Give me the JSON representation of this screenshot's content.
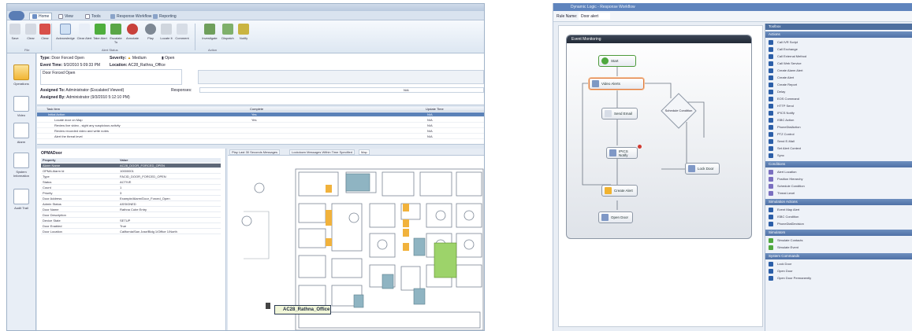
{
  "left_app": {
    "tabs": [
      {
        "label": "Home",
        "active": true
      },
      {
        "label": "View",
        "active": false
      },
      {
        "label": "Tools",
        "active": false
      },
      {
        "label": "Response Workflow",
        "active": false
      },
      {
        "label": "Reporting",
        "active": false
      }
    ],
    "ribbon_buttons": [
      "Save",
      "Clear",
      "Acknowledge",
      "Clear Alert",
      "Take Alert",
      "Escalate To",
      "Annotate",
      "Play",
      "Locate It",
      "Comment",
      "Investigate",
      "Dispatch",
      "Notify"
    ],
    "ribbon_groups": [
      "File",
      "Alert Status",
      "Action"
    ],
    "nav": [
      {
        "label": "Operations",
        "active": true
      },
      {
        "label": "Video",
        "active": false
      },
      {
        "label": "Alarm",
        "active": false
      },
      {
        "label": "System Information",
        "active": false
      },
      {
        "label": "Audit Trail",
        "active": false
      }
    ],
    "event": {
      "type_label": "Type:",
      "type_value": "Door Forced Open",
      "severity_label": "Severity:",
      "severity_value": "Medium",
      "state_value": "Open",
      "time_label": "Event Time:",
      "time_value": "9/3/2010 5:09:33 PM",
      "location_label": "Location:",
      "location_value": "AC28_Rathna_Office",
      "description": "Door Forced Open",
      "assigned_label": "Assigned To:",
      "assigned_value": "Administrator (Escalated Viewed)",
      "by_label": "Assigned By:",
      "by_value": "Administrator (9/3/2010 5:12:10 PM)",
      "resp_label": "Responses:",
      "resp_value": "N/A"
    },
    "tasks": {
      "headers": [
        "Task Item",
        "Complete",
        "Update Time"
      ],
      "rows": [
        {
          "name": "Initial Action",
          "complete": "Yes",
          "time": "N/A",
          "selected": true
        },
        {
          "name": "Locate door on Map",
          "complete": "Yes",
          "time": "N/A",
          "selected": false
        },
        {
          "name": "Review live video - sight any suspicious activity",
          "complete": "",
          "time": "N/A",
          "selected": false
        },
        {
          "name": "Review recorded video and write notes",
          "complete": "",
          "time": "N/A",
          "selected": false
        },
        {
          "name": "Alert the threat level",
          "complete": "",
          "time": "N/A",
          "selected": false
        }
      ]
    },
    "props": {
      "title": "OPMADoor",
      "headers": [
        "Property",
        "Value"
      ],
      "rows": [
        {
          "k": "Alarm Name",
          "v": "AC28_DOOR_FORCED_OPEN",
          "sel": true
        },
        {
          "k": "OPMA Alarm Id",
          "v": "10000001",
          "sel": false
        },
        {
          "k": "Type",
          "v": "FACID_DOOR_FORCED_OPEN",
          "sel": false
        },
        {
          "k": "Status",
          "v": "ACTIVE",
          "sel": false
        },
        {
          "k": "Count",
          "v": "1",
          "sel": false
        },
        {
          "k": "Priority",
          "v": "3",
          "sel": false
        },
        {
          "k": "Door Address",
          "v": "Example/Alarm/Door_Forced_Open",
          "sel": false
        },
        {
          "k": "Admin Status",
          "v": "ASSIGNED",
          "sel": false
        },
        {
          "k": "Door Name",
          "v": "Rathna Cube Entry",
          "sel": false
        },
        {
          "k": "Door Description",
          "v": "",
          "sel": false
        },
        {
          "k": "Device State",
          "v": "SETUP",
          "sel": false
        },
        {
          "k": "Door Enabled",
          "v": "True",
          "sel": false
        },
        {
          "k": "Door Location",
          "v": "California/San Jose/Bldg 1/Office 1/North",
          "sel": false
        }
      ]
    },
    "map_tabs": [
      "Play Last 30 Seconds Messages",
      "Lockdown Messages Within Time Specified",
      "Map"
    ],
    "map_label": "AC28_Rathna_Office"
  },
  "right_app": {
    "title": "Dynamic Logic - Response Workflow",
    "name_label": "Rule Name:",
    "name_value": "Door alert",
    "canvas_title": "Event Monitoring",
    "nodes": {
      "start": "Start",
      "video": "Video Alerts",
      "condition": "Schedule Condition",
      "email": "Send Email",
      "notify": "IPICS Notify",
      "lock": "Lock Door",
      "alert": "Create Alert",
      "open": "Open Door"
    },
    "toolbox_header": "Toolbox",
    "sections": [
      {
        "title": "Actions",
        "items": [
          "Call IVR Script",
          "Call Exchange",
          "Call External Method",
          "Call Web Service",
          "Create Alarm Alert",
          "Create Alert",
          "Create Report",
          "Delay",
          "EOS Command",
          "HTTP Send",
          "IPICS Notify",
          "ISBC Action",
          "PhoneDialAction",
          "PTZ Control",
          "Send E-Mail",
          "Set Alert Context",
          "Sync"
        ]
      },
      {
        "title": "Conditions",
        "items": [
          "Alert Location",
          "Position Hierarchy",
          "Schedule Condition",
          "Threat Level"
        ]
      },
      {
        "title": "Simulation Actions",
        "items": [
          "Event Map Alert",
          "ISBC Condition",
          "PhoneDialDecision"
        ]
      },
      {
        "title": "Simulators",
        "items": [
          "Simulate Contacts",
          "Simulate Event"
        ]
      },
      {
        "title": "System Commands",
        "items": [
          "Lock Door",
          "Open Door",
          "Open Door Permanently"
        ]
      }
    ]
  },
  "colors": {
    "accent": "#5f84bd",
    "selection": "#5b82b8",
    "severity": "#f2b534"
  }
}
